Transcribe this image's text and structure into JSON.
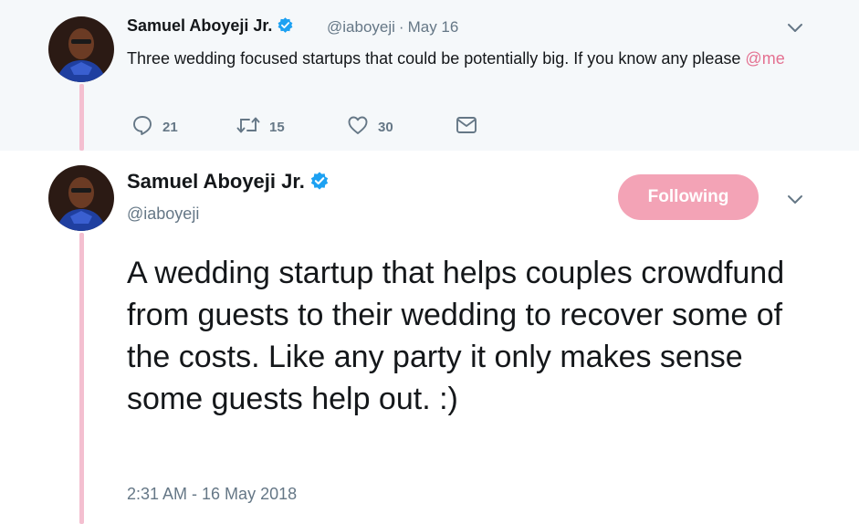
{
  "parent_tweet": {
    "name": "Samuel Aboyeji Jr.",
    "handle": "@iaboyeji",
    "separator": "·",
    "date": "May 16",
    "text_before_mention": "Three wedding focused startups that could be potentially big. If you know any please ",
    "mention": "@me",
    "actions": {
      "replies": "21",
      "retweets": "15",
      "likes": "30"
    }
  },
  "main_tweet": {
    "name": "Samuel Aboyeji Jr.",
    "handle": "@iaboyeji",
    "follow_label": "Following",
    "text": "A wedding startup that helps couples crowdfund from guests to their wedding to recover some of the costs. Like any party it only makes sense some guests help out. :)",
    "timestamp": "2:31 AM - 16 May 2018"
  },
  "icons": {
    "avatar": "avatar",
    "verified": "verified-badge-icon",
    "chevron": "chevron-down-icon",
    "reply": "reply-icon",
    "retweet": "retweet-icon",
    "like": "heart-icon",
    "dm": "envelope-icon"
  },
  "colors": {
    "accent_pink": "#f3a3b6",
    "mention_pink": "#e47191",
    "thread_line": "#f4bfd0",
    "verified_blue": "#1da1f2",
    "muted_text": "#657786",
    "parent_bg": "#f5f8fa"
  }
}
